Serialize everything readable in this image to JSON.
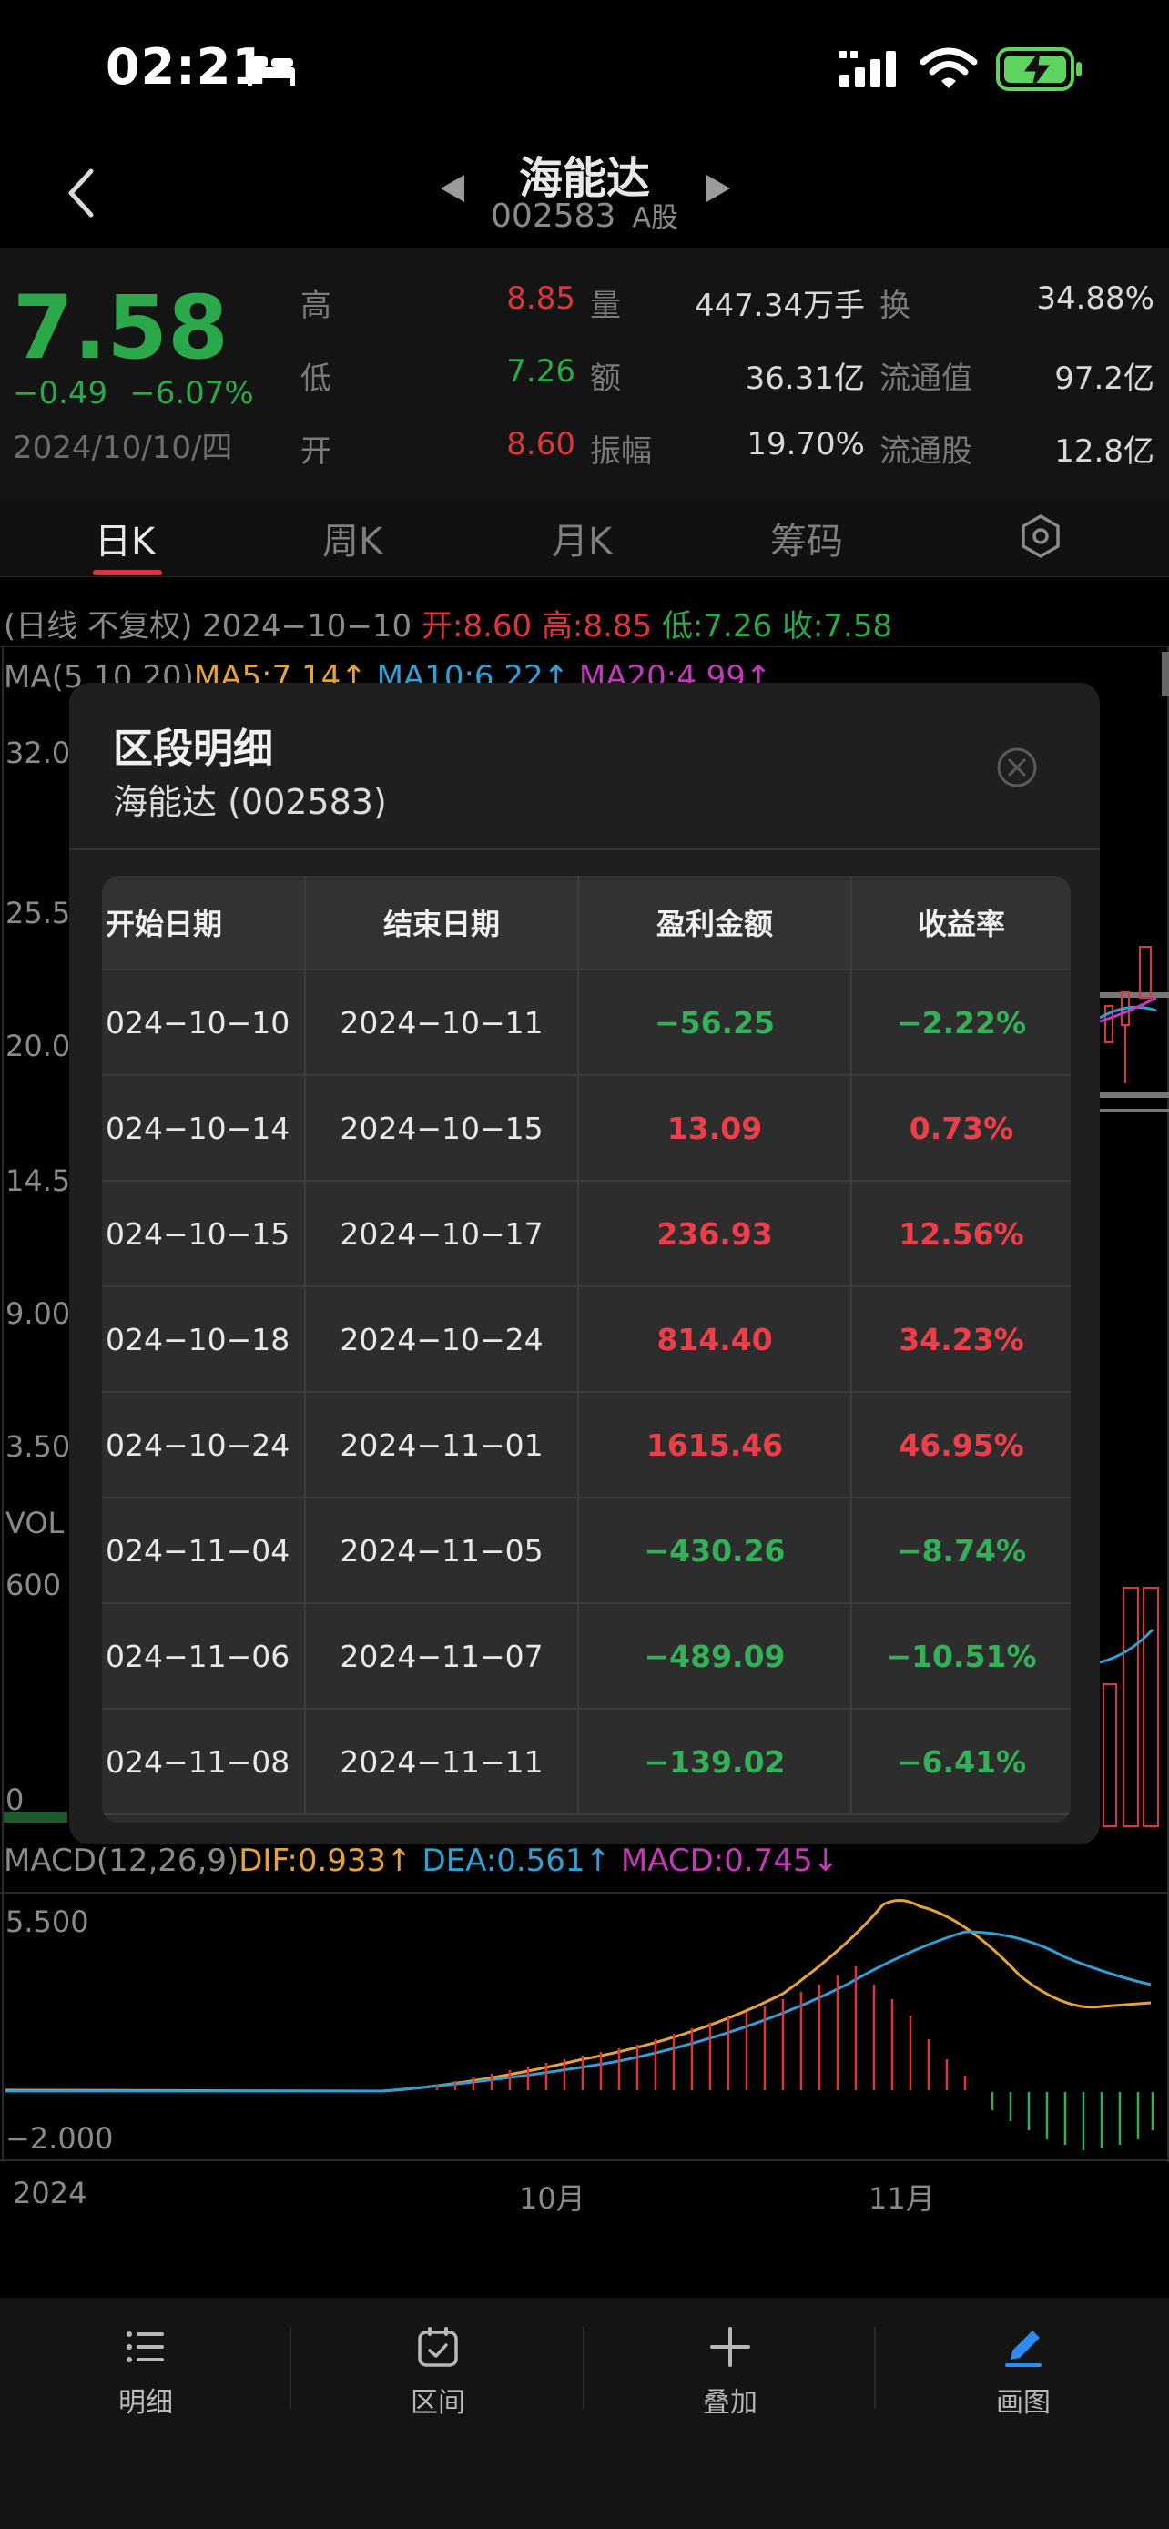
{
  "status_bar": {
    "time": "02:21"
  },
  "nav": {
    "stock_name": "海能达",
    "stock_code": "002583",
    "market": "A股"
  },
  "quote": {
    "price": "7.58",
    "change": "−0.49",
    "change_pct": "−6.07%",
    "date": "2024/10/10/四",
    "high_label": "高",
    "high": "8.85",
    "low_label": "低",
    "low": "7.26",
    "open_label": "开",
    "open": "8.60",
    "volume_label": "量",
    "volume": "447.34万手",
    "amount_label": "额",
    "amount": "36.31亿",
    "amplitude_label": "振幅",
    "amplitude": "19.70%",
    "turnover_label": "换",
    "turnover": "34.88%",
    "float_value_label": "流通值",
    "float_value": "97.2亿",
    "float_shares_label": "流通股",
    "float_shares": "12.8亿"
  },
  "tabs": {
    "day": "日K",
    "week": "周K",
    "month": "月K",
    "chips": "筹码"
  },
  "kline": {
    "mode": "(日线 不复权)",
    "date": "2024−10−10",
    "open": "开:8.60",
    "high": "高:8.85",
    "low": "低:7.26",
    "close": "收:7.58",
    "ma_label": "MA(5,10,20)",
    "ma5": "MA5:7.14↑",
    "ma10": "MA10:6.22↑",
    "ma20": "MA20:4.99↑"
  },
  "price_axis": [
    "32.0",
    "25.5",
    "20.0",
    "14.5",
    "9.00",
    "3.50"
  ],
  "volume": {
    "label": "VOL",
    "top": "600",
    "zero": "0"
  },
  "macd": {
    "label": "MACD(12,26,9)",
    "dif": "DIF:0.933↑",
    "dea": "DEA:0.561↑",
    "macd": "MACD:0.745↓",
    "top": "5.500",
    "bottom": "−2.000"
  },
  "x_axis": {
    "start": "2024",
    "oct": "10月",
    "nov": "11月"
  },
  "modal": {
    "title": "区段明细",
    "subtitle": "海能达 (002583)",
    "headers": [
      "开始日期",
      "结束日期",
      "盈利金额",
      "收益率"
    ],
    "rows": [
      {
        "start": "024−10−10",
        "end": "2024−10−11",
        "profit": "−56.25",
        "rate": "−2.22%"
      },
      {
        "start": "024−10−14",
        "end": "2024−10−15",
        "profit": "13.09",
        "rate": "0.73%"
      },
      {
        "start": "024−10−15",
        "end": "2024−10−17",
        "profit": "236.93",
        "rate": "12.56%"
      },
      {
        "start": "024−10−18",
        "end": "2024−10−24",
        "profit": "814.40",
        "rate": "34.23%"
      },
      {
        "start": "024−10−24",
        "end": "2024−11−01",
        "profit": "1615.46",
        "rate": "46.95%"
      },
      {
        "start": "024−11−04",
        "end": "2024−11−05",
        "profit": "−430.26",
        "rate": "−8.74%"
      },
      {
        "start": "024−11−06",
        "end": "2024−11−07",
        "profit": "−489.09",
        "rate": "−10.51%"
      },
      {
        "start": "024−11−08",
        "end": "2024−11−11",
        "profit": "−139.02",
        "rate": "−6.41%"
      }
    ]
  },
  "bottom_bar": {
    "detail": "明细",
    "range": "区间",
    "overlay": "叠加",
    "draw": "画图"
  },
  "colors": {
    "up": "#ef3e4a",
    "down": "#34b158",
    "accent": "#e0333a",
    "draw_active": "#2e8cf0"
  }
}
